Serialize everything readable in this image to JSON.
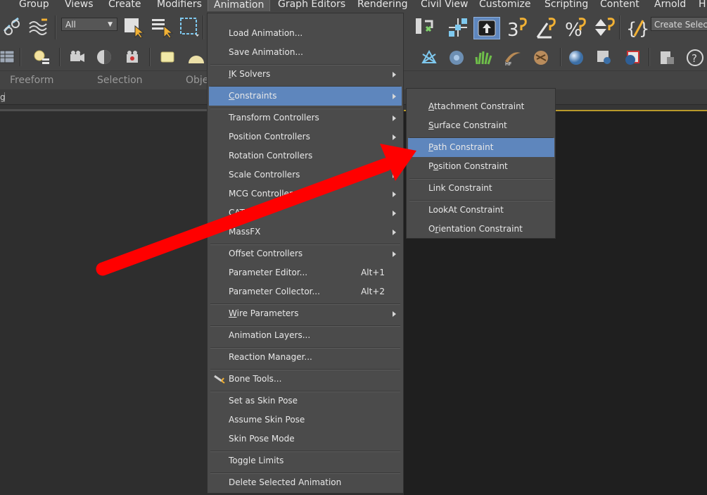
{
  "menubar": {
    "items": [
      {
        "id": "group",
        "label": "Group"
      },
      {
        "id": "views",
        "label": "Views"
      },
      {
        "id": "create",
        "label": "Create"
      },
      {
        "id": "modifiers",
        "label": "Modifiers"
      },
      {
        "id": "animation",
        "label": "Animation"
      },
      {
        "id": "graph-editors",
        "label": "Graph Editors"
      },
      {
        "id": "rendering",
        "label": "Rendering"
      },
      {
        "id": "civil-view",
        "label": "Civil View"
      },
      {
        "id": "customize",
        "label": "Customize"
      },
      {
        "id": "scripting",
        "label": "Scripting"
      },
      {
        "id": "content",
        "label": "Content"
      },
      {
        "id": "arnold",
        "label": "Arnold"
      },
      {
        "id": "help",
        "label": "H"
      }
    ]
  },
  "toolbar": {
    "filter_value": "All",
    "create_selection_label": "Create Selection",
    "spinner_snap_label": "3",
    "percent_label": "%"
  },
  "ribbon": {
    "tabs": [
      "Freeform",
      "Selection",
      "Obje"
    ]
  },
  "strip": {
    "fragment": "g"
  },
  "animation_menu": {
    "items": [
      {
        "label": "Load Animation...",
        "underline": "",
        "submenu": false,
        "shortcut": ""
      },
      {
        "label": "Save Animation...",
        "underline": "",
        "submenu": false,
        "shortcut": ""
      },
      {
        "label": "IK Solvers",
        "underline": "I",
        "submenu": true,
        "shortcut": ""
      },
      {
        "label": "Constraints",
        "underline": "C",
        "submenu": true,
        "shortcut": "",
        "highlighted": true
      },
      {
        "label": "Transform Controllers",
        "underline": "",
        "submenu": true,
        "shortcut": ""
      },
      {
        "label": "Position Controllers",
        "underline": "",
        "submenu": true,
        "shortcut": ""
      },
      {
        "label": "Rotation Controllers",
        "underline": "",
        "submenu": true,
        "shortcut": ""
      },
      {
        "label": "Scale Controllers",
        "underline": "",
        "submenu": true,
        "shortcut": ""
      },
      {
        "label": "MCG Controllers",
        "underline": "",
        "submenu": true,
        "shortcut": ""
      },
      {
        "label": "CAT",
        "underline": "",
        "submenu": true,
        "shortcut": ""
      },
      {
        "label": "MassFX",
        "underline": "",
        "submenu": true,
        "shortcut": ""
      },
      {
        "label": "Offset Controllers",
        "underline": "",
        "submenu": true,
        "shortcut": ""
      },
      {
        "label": "Parameter Editor...",
        "underline": "",
        "submenu": false,
        "shortcut": "Alt+1"
      },
      {
        "label": "Parameter Collector...",
        "underline": "",
        "submenu": false,
        "shortcut": "Alt+2"
      },
      {
        "label": "Wire Parameters",
        "underline": "W",
        "submenu": true,
        "shortcut": ""
      },
      {
        "label": "Animation Layers...",
        "underline": "",
        "submenu": false,
        "shortcut": ""
      },
      {
        "label": "Reaction Manager...",
        "underline": "",
        "submenu": false,
        "shortcut": ""
      },
      {
        "label": "Bone Tools...",
        "underline": "",
        "submenu": false,
        "shortcut": "",
        "icon": "bone-tools-icon"
      },
      {
        "label": "Set as Skin Pose",
        "underline": "",
        "submenu": false,
        "shortcut": ""
      },
      {
        "label": "Assume Skin Pose",
        "underline": "",
        "submenu": false,
        "shortcut": ""
      },
      {
        "label": "Skin Pose Mode",
        "underline": "",
        "submenu": false,
        "shortcut": ""
      },
      {
        "label": "Toggle Limits",
        "underline": "",
        "submenu": false,
        "shortcut": ""
      },
      {
        "label": "Delete Selected Animation",
        "underline": "",
        "submenu": false,
        "shortcut": ""
      }
    ]
  },
  "constraints_submenu": {
    "items": [
      {
        "label": "Attachment Constraint",
        "underline": "A"
      },
      {
        "label": "Surface Constraint",
        "underline": "S"
      },
      {
        "label": "Path Constraint",
        "underline": "P",
        "highlighted": true
      },
      {
        "label": "Position Constraint",
        "underline": "o"
      },
      {
        "label": "Link Constraint",
        "underline": ""
      },
      {
        "label": "LookAt Constraint",
        "underline": ""
      },
      {
        "label": "Orientation Constraint",
        "underline": "r"
      }
    ]
  },
  "colors": {
    "menu_bg": "#4b4b4b",
    "highlight": "#5e86bd",
    "arrow": "#ff0000",
    "viewport_border": "#b99a2b"
  }
}
